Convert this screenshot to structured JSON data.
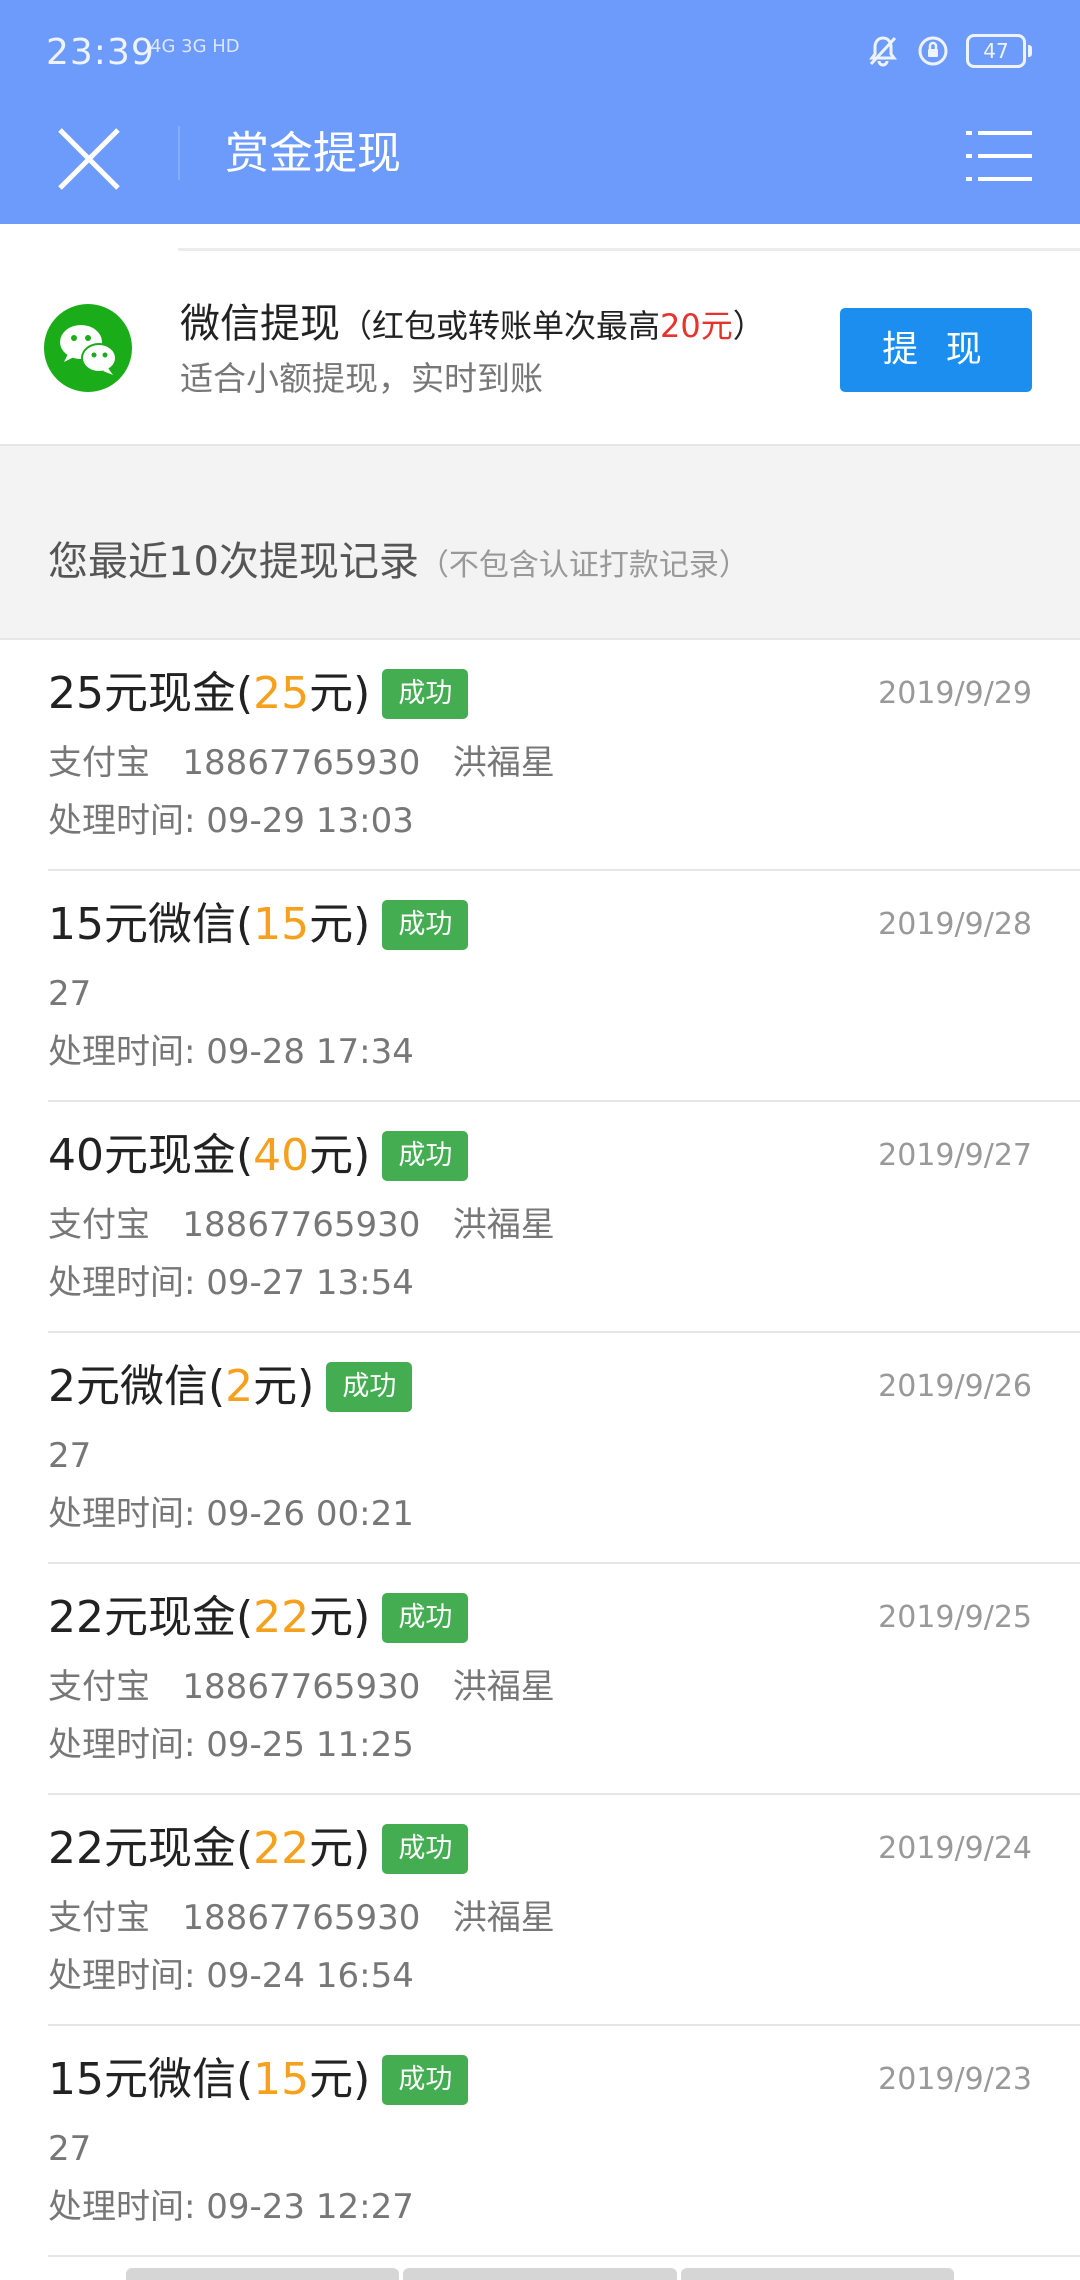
{
  "status_bar": {
    "time": "23:39",
    "signal": "4G 3G HD",
    "battery": "47"
  },
  "nav": {
    "title": "赏金提现"
  },
  "wechat_withdraw": {
    "title": "微信提现",
    "note_prefix": "（红包或转账单次最高",
    "note_amount": "20元",
    "note_suffix": "）",
    "subtitle": "适合小额提现，实时到账",
    "button_label": "提 现"
  },
  "records_header": {
    "title": "您最近10次提现记录",
    "note": "（不包含认证打款记录）"
  },
  "colors": {
    "header": "#6d9bfb",
    "button": "#1b8ef0",
    "success": "#44ad52",
    "amount": "#f5a11d",
    "highlight_red": "#e8332c"
  },
  "records": [
    {
      "label": "25元现金",
      "amount": "25",
      "status": "成功",
      "date": "2019/9/29",
      "account": "支付宝   18867765930   洪福星",
      "time": "处理时间: 09-29 13:03"
    },
    {
      "label": "15元微信",
      "amount": "15",
      "status": "成功",
      "date": "2019/9/28",
      "account": "27",
      "time": "处理时间: 09-28 17:34"
    },
    {
      "label": "40元现金",
      "amount": "40",
      "status": "成功",
      "date": "2019/9/27",
      "account": "支付宝   18867765930   洪福星",
      "time": "处理时间: 09-27 13:54"
    },
    {
      "label": "2元微信",
      "amount": "2",
      "status": "成功",
      "date": "2019/9/26",
      "account": "27",
      "time": "处理时间: 09-26 00:21"
    },
    {
      "label": "22元现金",
      "amount": "22",
      "status": "成功",
      "date": "2019/9/25",
      "account": "支付宝   18867765930   洪福星",
      "time": "处理时间: 09-25 11:25"
    },
    {
      "label": "22元现金",
      "amount": "22",
      "status": "成功",
      "date": "2019/9/24",
      "account": "支付宝   18867765930   洪福星",
      "time": "处理时间: 09-24 16:54"
    },
    {
      "label": "15元微信",
      "amount": "15",
      "status": "成功",
      "date": "2019/9/23",
      "account": "27",
      "time": "处理时间: 09-23 12:27"
    }
  ]
}
